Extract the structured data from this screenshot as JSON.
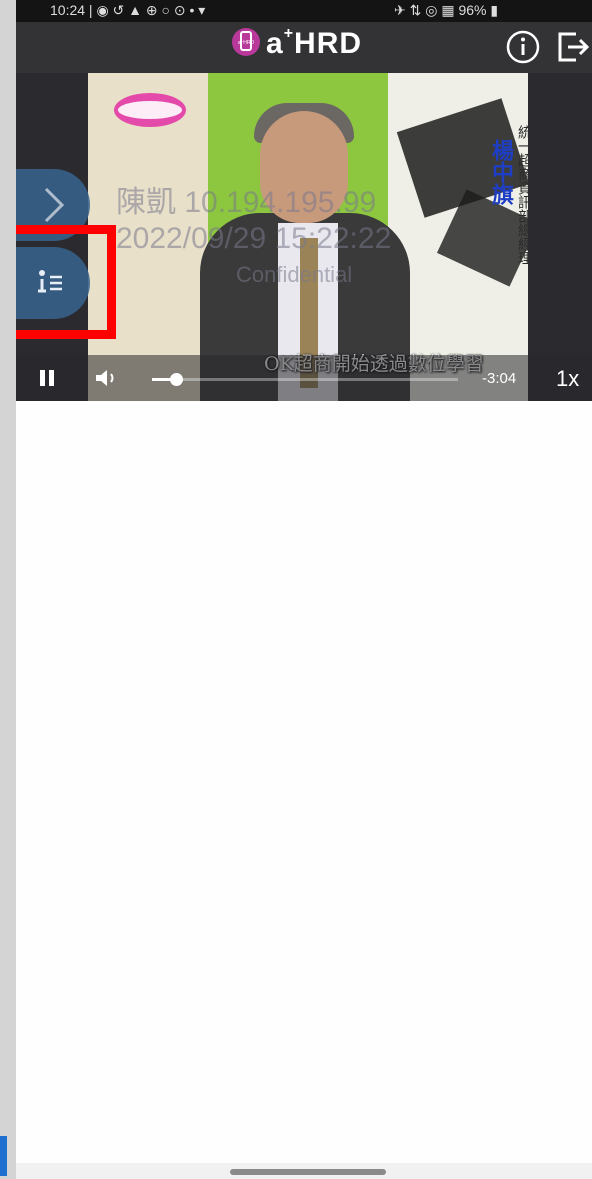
{
  "status_bar": {
    "left": "10:24 | ◉ ↺ ▲ ⊕ ○ ⊙ • ▾",
    "right": "✈ ⇅ ◎ ▦ 96% ▮"
  },
  "app_bar": {
    "badge_text": "a⁺HRD",
    "title_main": "a",
    "title_sup": "+",
    "title_suffix": "HRD",
    "info_icon": "info-circle-icon",
    "exit_icon": "logout-icon"
  },
  "video": {
    "watermark_line1": "陳凱 10.194.195.99",
    "watermark_line2": "2022/09/29 15:22:22",
    "watermark_line3": "Confidential",
    "subtitle": "OK超商開始透過數位學習",
    "caption_name": "楊中旗",
    "caption_title": "統一超商資訊部總經理",
    "side_tabs": [
      {
        "icon": "chevron-right-icon"
      },
      {
        "icon": "info-list-icon"
      }
    ]
  },
  "player_controls": {
    "play_state_icon": "pause-icon",
    "volume_icon": "volume-icon",
    "progress_fraction": 0.08,
    "time_remaining": "-3:04",
    "speed": "1x"
  },
  "colors": {
    "app_bar": "#333336",
    "brand_magenta": "#b9399a",
    "side_tab": "#38628c",
    "highlight": "#ff0000"
  }
}
